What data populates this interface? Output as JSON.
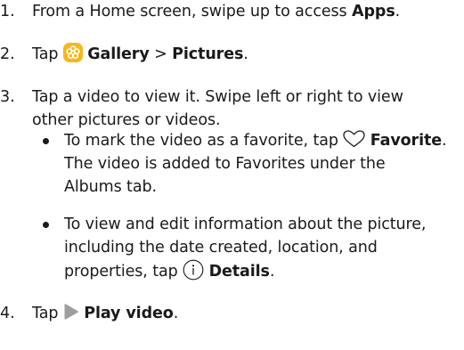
{
  "steps": [
    {
      "number": "1.",
      "pre": "From a Home screen, swipe up to access ",
      "bold": "Apps",
      "post": "."
    },
    {
      "number": "2.",
      "pre": "Tap ",
      "icon": "gallery-icon",
      "bold1": "Gallery",
      "sep": " > ",
      "bold2": "Pictures",
      "post": "."
    },
    {
      "number": "3.",
      "line1": "Tap a video to view it. Swipe left or right to view",
      "line2": "other pictures or videos.",
      "bullets": [
        {
          "line1_pre": "To mark the video as a favorite, tap ",
          "icon": "heart-icon",
          "line1_bold": "Favorite",
          "line1_post": ".",
          "line2": "The video is added to Favorites under the",
          "line3": "Albums tab."
        },
        {
          "line1": "To view and edit information about the picture,",
          "line2": "including the date created, location, and",
          "line3_pre": "properties, tap ",
          "icon": "info-icon",
          "line3_bold": "Details",
          "line3_post": "."
        }
      ]
    },
    {
      "number": "4.",
      "pre": "Tap ",
      "icon": "play-icon",
      "bold": "Play video",
      "post": "."
    }
  ],
  "colors": {
    "text": "#1a1a1a",
    "gallery_icon": "#f5b81c",
    "play_icon": "#9e9e9e"
  }
}
